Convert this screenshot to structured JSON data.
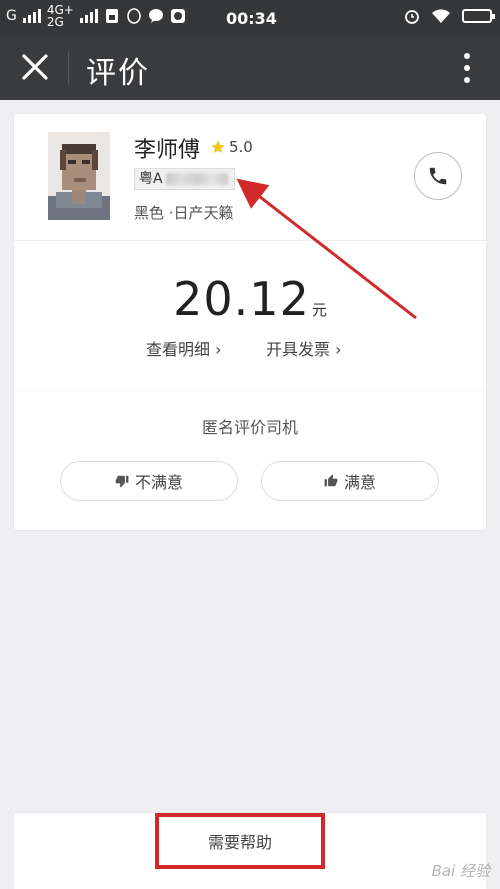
{
  "status_bar": {
    "network1": "G",
    "network2_top": "4G+",
    "network2_bottom": "2G",
    "time": "00:34"
  },
  "title_bar": {
    "title": "评价"
  },
  "driver": {
    "name": "李师傅",
    "rating": "5.0",
    "plate_prefix": "粤A",
    "car_info": "黑色 ·日产天籁"
  },
  "fare": {
    "amount": "20.12",
    "unit": "元",
    "detail_link": "查看明细 ›",
    "invoice_link": "开具发票 ›"
  },
  "review": {
    "title": "匿名评价司机",
    "dissatisfied_label": "不满意",
    "satisfied_label": "满意"
  },
  "help": {
    "label": "需要帮助"
  },
  "watermark": "Bai 经验",
  "colors": {
    "status_bar_bg": "#363738",
    "title_bar_bg": "#3a3b3d",
    "page_bg": "#efeff2",
    "annotation_red": "#d12a2a",
    "star_yellow": "#f5c518"
  }
}
